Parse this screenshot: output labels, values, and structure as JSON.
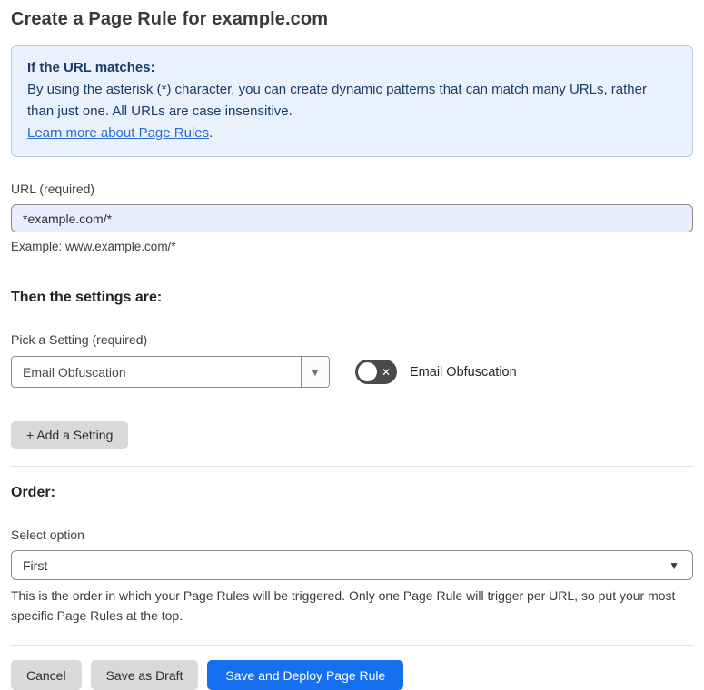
{
  "page": {
    "title": "Create a Page Rule for example.com"
  },
  "info_box": {
    "heading": "If the URL matches:",
    "body": "By using the asterisk (*) character, you can create dynamic patterns that can match many URLs, rather than just one. All URLs are case insensitive.",
    "link": "Learn more about Page Rules",
    "link_suffix": "."
  },
  "url_field": {
    "label": "URL (required)",
    "value": "*example.com/*",
    "example": "Example: www.example.com/*"
  },
  "settings": {
    "heading": "Then the settings are:",
    "pick_label": "Pick a Setting (required)",
    "selected_setting": "Email Obfuscation",
    "toggle_label": "Email Obfuscation",
    "toggle_state": "off",
    "add_button_label": "+ Add a Setting"
  },
  "order": {
    "heading": "Order:",
    "select_label": "Select option",
    "selected_option": "First",
    "help": "This is the order in which your Page Rules will be triggered. Only one Page Rule will trigger per URL, so put your most specific Page Rules at the top."
  },
  "footer": {
    "cancel_label": "Cancel",
    "save_draft_label": "Save as Draft",
    "save_deploy_label": "Save and Deploy Page Rule"
  },
  "icons": {
    "dropdown_arrow": "▼",
    "select_arrow": "▼",
    "toggle_off_glyph": "✕"
  },
  "colors": {
    "accent_blue": "#1570ef",
    "info_bg": "#e9f2fc",
    "info_border": "#b0d0ec",
    "info_text": "#1b3a66",
    "input_bg": "#e8eefb",
    "toggle_off_bg": "#4a4a4a",
    "button_gray": "#d9d9d9"
  }
}
